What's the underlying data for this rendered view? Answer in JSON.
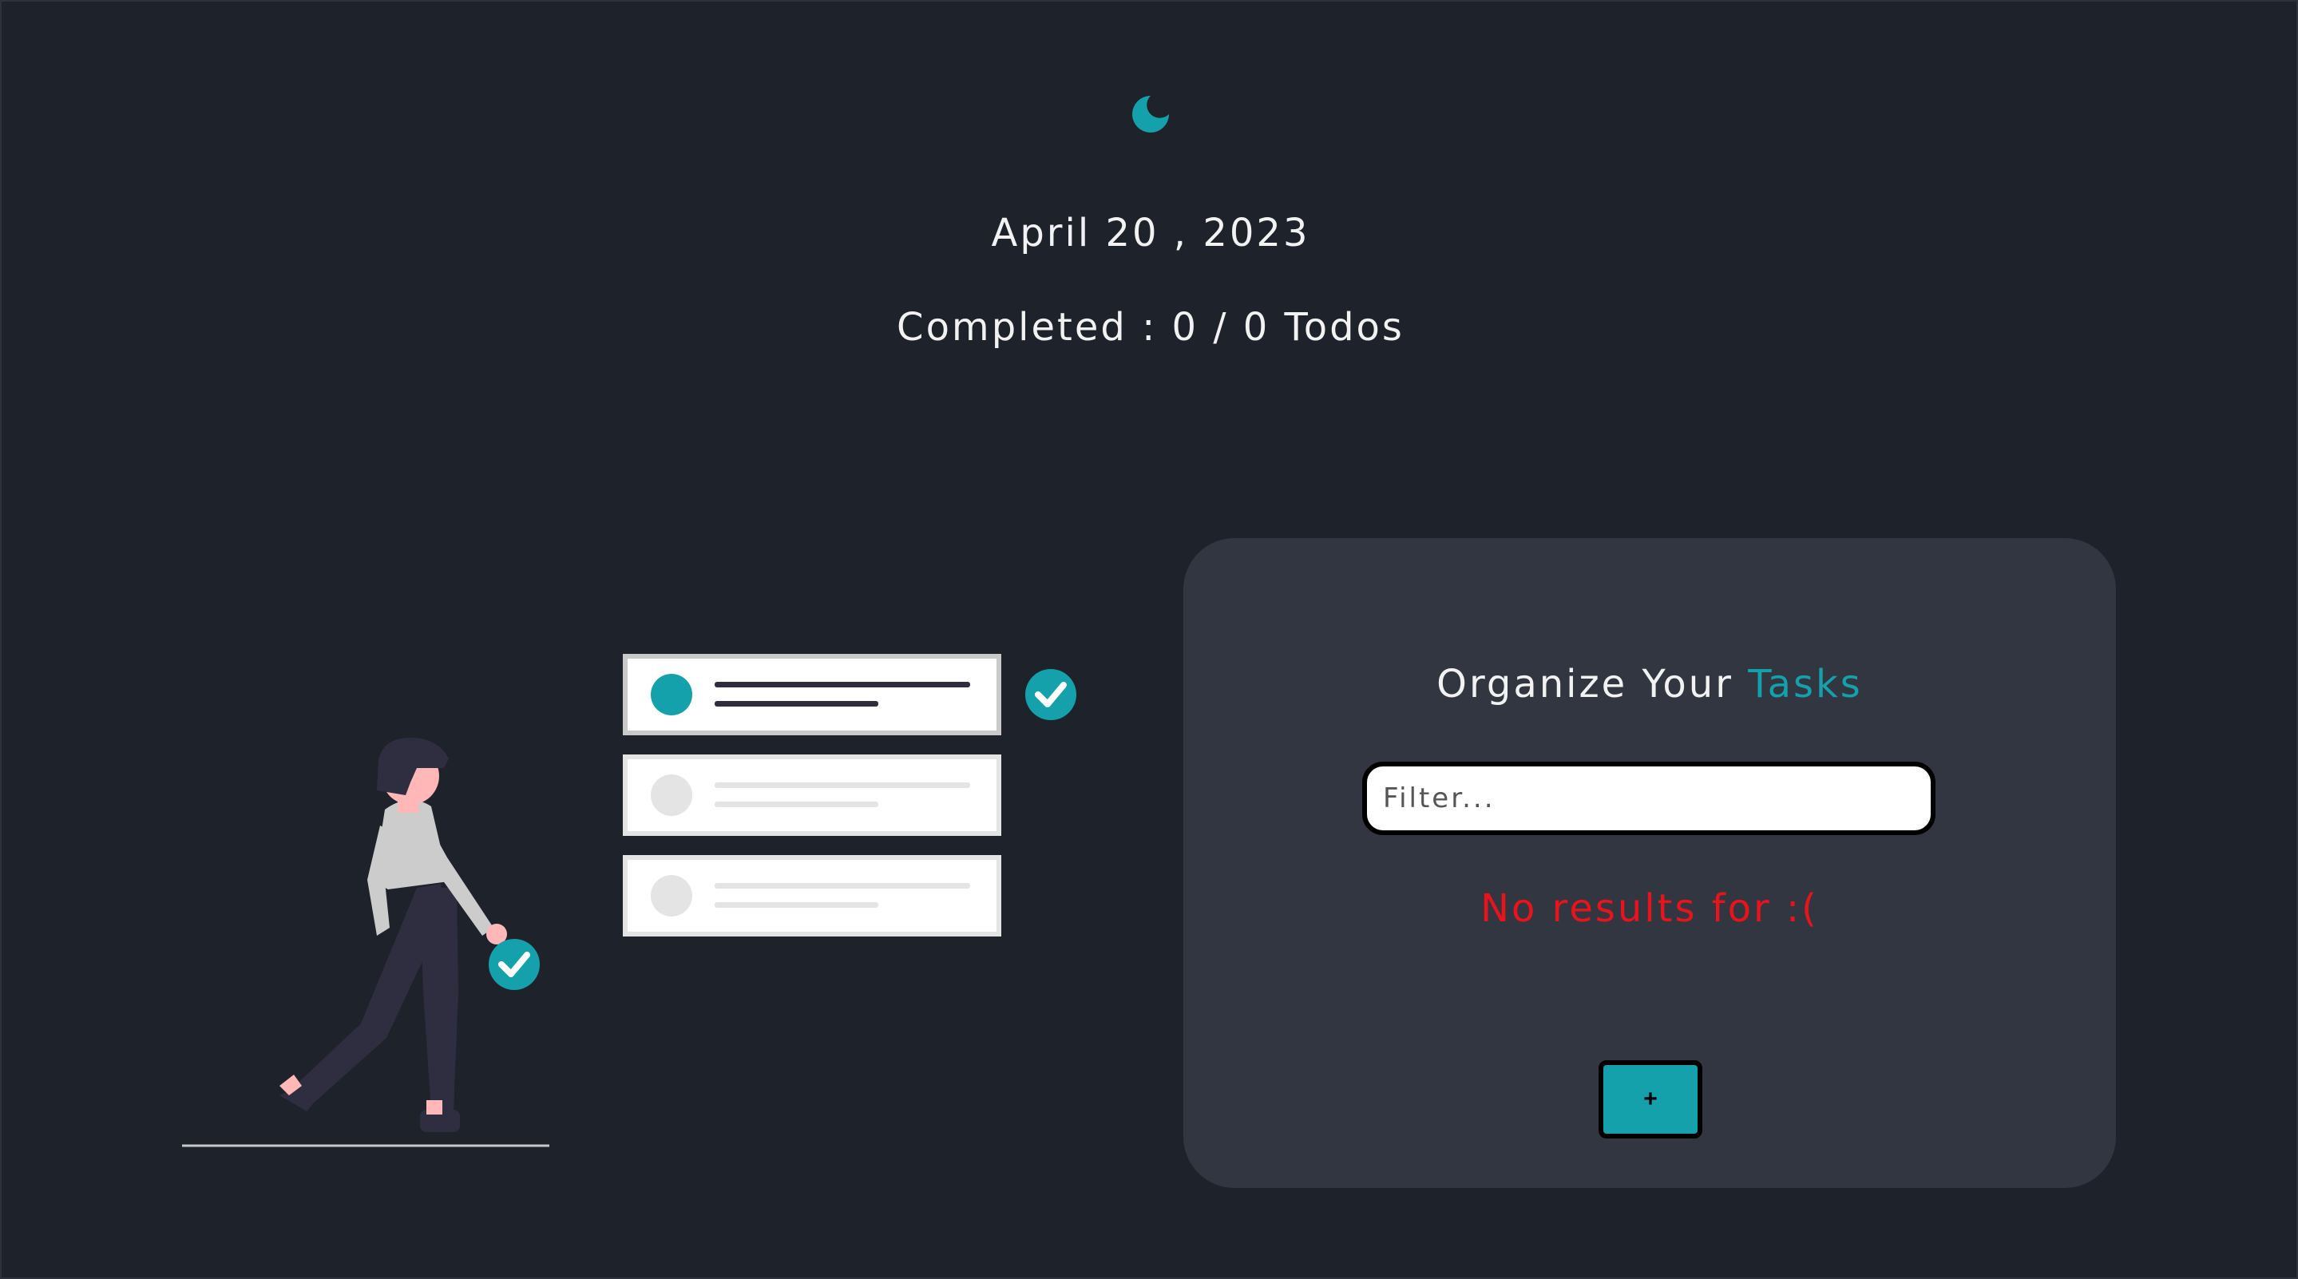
{
  "header": {
    "theme_toggle_icon": "moon-icon",
    "date": "April 20 , 2023",
    "completed_text": "Completed : 0 / 0 Todos"
  },
  "panel": {
    "title_prefix": "Organize Your",
    "title_accent": "Tasks",
    "filter": {
      "value": "",
      "placeholder": "Filter..."
    },
    "no_results_text": "No results for :(",
    "add_button_label": "+"
  },
  "colors": {
    "background": "#1e222a",
    "panel": "#323640",
    "accent": "#14a1ab",
    "error": "#e8131b",
    "text": "#f2f2f2"
  }
}
